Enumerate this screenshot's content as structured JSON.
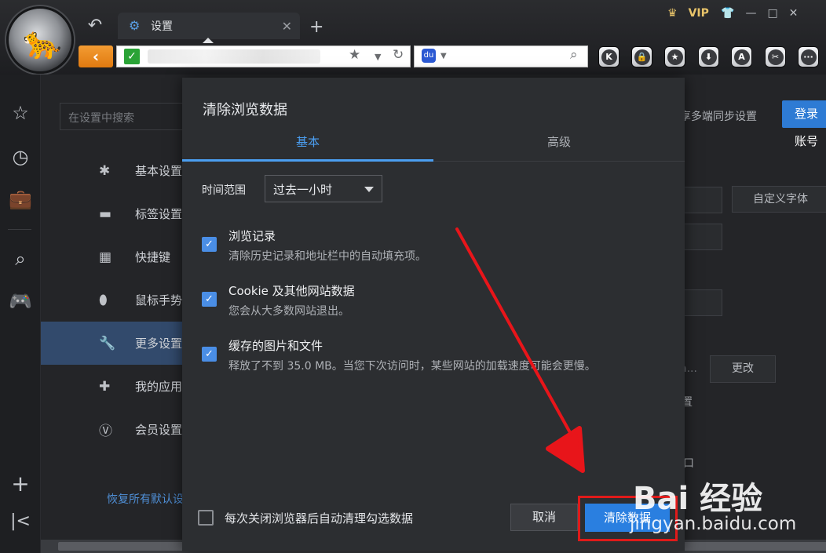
{
  "browser": {
    "tab_title": "设置",
    "vip_label": "VIP",
    "toolbar_buttons": [
      "K",
      "lock",
      "star",
      "download",
      "A",
      "scissors",
      "more"
    ]
  },
  "sidebar_icons": [
    "star-icon",
    "clock-icon",
    "briefcase-icon",
    "search-icon",
    "gamepad-icon",
    "plus-icon",
    "collapse-icon"
  ],
  "settings": {
    "search_placeholder": "在设置中搜索",
    "menu": [
      "基本设置",
      "标签设置",
      "快捷键",
      "鼠标手势",
      "更多设置",
      "我的应用",
      "会员设置"
    ],
    "active_menu": "更多设置",
    "restore_label": "恢复所有默认设置",
    "sync_text": "享多端同步设置",
    "login_label": "登录账号",
    "custom_font_label": "自定义字体",
    "change_label": "更改",
    "path_text": "a...",
    "setting_text": "置",
    "misc_text": "口"
  },
  "dialog": {
    "title": "清除浏览数据",
    "tabs": [
      "基本",
      "高级"
    ],
    "active_tab": "基本",
    "time_range_label": "时间范围",
    "time_range_value": "过去一小时",
    "items": [
      {
        "title": "浏览记录",
        "desc": "清除历史记录和地址栏中的自动填充项。",
        "checked": true
      },
      {
        "title": "Cookie 及其他网站数据",
        "desc": "您会从大多数网站退出。",
        "checked": true
      },
      {
        "title": "缓存的图片和文件",
        "desc": "释放了不到 35.0 MB。当您下次访问时，某些网站的加载速度可能会更慢。",
        "checked": true
      }
    ],
    "auto_clear_label": "每次关闭浏览器后自动清理勾选数据",
    "auto_clear_checked": false,
    "cancel_label": "取消",
    "clear_label": "清除数据"
  },
  "watermark": {
    "brand": "Bai 经验",
    "url": "jingyan.baidu.com"
  },
  "colors": {
    "accent": "#2a7fe0",
    "highlight_box": "#e01a1a",
    "arrow": "#e8151a"
  }
}
